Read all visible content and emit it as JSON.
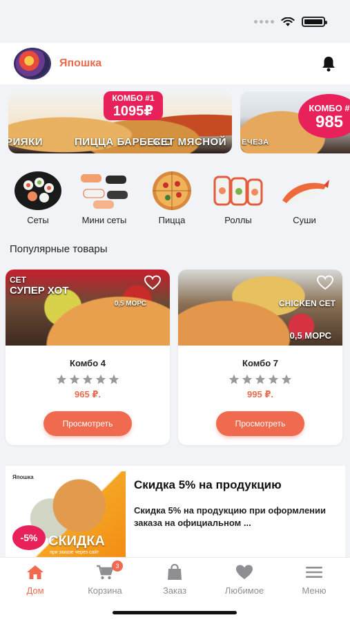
{
  "header": {
    "brand": "Япошка"
  },
  "banners": [
    {
      "badge_line1": "КОМБО #1",
      "badge_line2": "1095₽",
      "caption_left": "РИЯКИ",
      "caption_mid": "ПИЦЦА БАРБЕКЮ",
      "caption_right": "СЕТ МЯСНОЙ"
    },
    {
      "badge_line1": "КОМБО #",
      "badge_line2": "985",
      "caption": "ЕЧЕЗА"
    }
  ],
  "categories": [
    {
      "label": "Сеты"
    },
    {
      "label": "Мини сеты"
    },
    {
      "label": "Пицца"
    },
    {
      "label": "Роллы"
    },
    {
      "label": "Суши"
    }
  ],
  "popular": {
    "title": "Популярные товары",
    "products": [
      {
        "name": "Комбо 4",
        "price": "965 ₽.",
        "rating": 0,
        "button": "Просмотреть",
        "img_text1": "СЕТ",
        "img_text2": "СУПЕР ХОТ",
        "img_text3": "0,5 МОРС"
      },
      {
        "name": "Комбо 7",
        "price": "995 ₽.",
        "rating": 0,
        "button": "Просмотреть",
        "img_text1": "CHICKEN СЕТ",
        "img_text2": "0,5 МОРС"
      }
    ]
  },
  "promo": {
    "title": "Скидка 5% на продукцию",
    "description": "Скидка 5% на продукцию при оформлении заказа на официальном ...",
    "img_logo": "Япошка",
    "img_discount": "-5%",
    "img_big": "СКИДКА",
    "img_small": "при заказе через сайт"
  },
  "tabbar": {
    "items": [
      {
        "label": "Дом",
        "icon": "home-icon",
        "active": true
      },
      {
        "label": "Корзина",
        "icon": "cart-icon",
        "badge": "3"
      },
      {
        "label": "Заказ",
        "icon": "bag-icon"
      },
      {
        "label": "Любимое",
        "icon": "heart-icon"
      },
      {
        "label": "Меню",
        "icon": "menu-icon"
      }
    ]
  },
  "colors": {
    "accent": "#f06a50",
    "badge_pink": "#e8215a",
    "background": "#f1f3f7"
  }
}
